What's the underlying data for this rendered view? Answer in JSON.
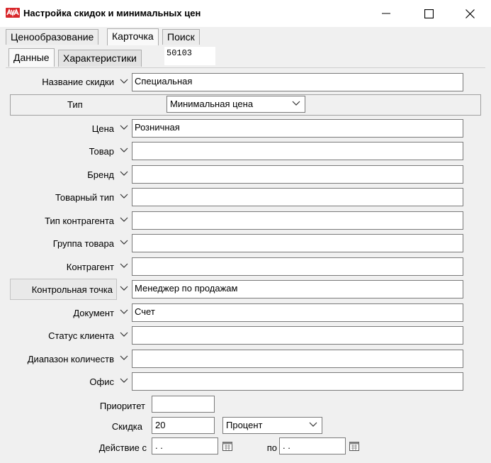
{
  "window": {
    "title": "Настройка скидок и минимальных цен",
    "icon": "app-logo-icon",
    "controls": [
      "minimize-icon",
      "maximize-icon",
      "close-icon"
    ]
  },
  "tabs": [
    "Ценообразование",
    "Карточка",
    "Поиск"
  ],
  "active_tab": "Карточка",
  "subtabs": [
    "Данные",
    "Характеристики"
  ],
  "active_subtab": "Данные",
  "record_id": "50103",
  "discount_name": {
    "label": "Название скидки",
    "value": "Специальная"
  },
  "type": {
    "label": "Тип",
    "value": "Минимальная цена"
  },
  "filters": [
    {
      "label": "Цена",
      "value": "Розничная"
    },
    {
      "label": "Товар",
      "value": ""
    },
    {
      "label": "Бренд",
      "value": ""
    },
    {
      "label": "Товарный тип",
      "value": ""
    },
    {
      "label": "Тип контрагента",
      "value": ""
    },
    {
      "label": "Группа товара",
      "value": ""
    },
    {
      "label": "Контрагент",
      "value": ""
    },
    {
      "label": "Контрольная точка",
      "value": "Менеджер по продажам"
    },
    {
      "label": "Документ",
      "value": "Счет"
    },
    {
      "label": "Статус клиента",
      "value": ""
    },
    {
      "label": "Диапазон количеств",
      "value": ""
    },
    {
      "label": "Офис",
      "value": ""
    }
  ],
  "priority": {
    "label": "Приоритет",
    "value": ""
  },
  "discount": {
    "label": "Скидка",
    "value": "20",
    "unit": "Процент"
  },
  "period": {
    "from_label": "Действие с",
    "from_value": " .  .",
    "to_label": "по",
    "to_value": " .  ."
  },
  "colors": {
    "brand": "#d8262a",
    "field_border": "#7a7a7a",
    "window_bg": "#f0f0f0"
  }
}
